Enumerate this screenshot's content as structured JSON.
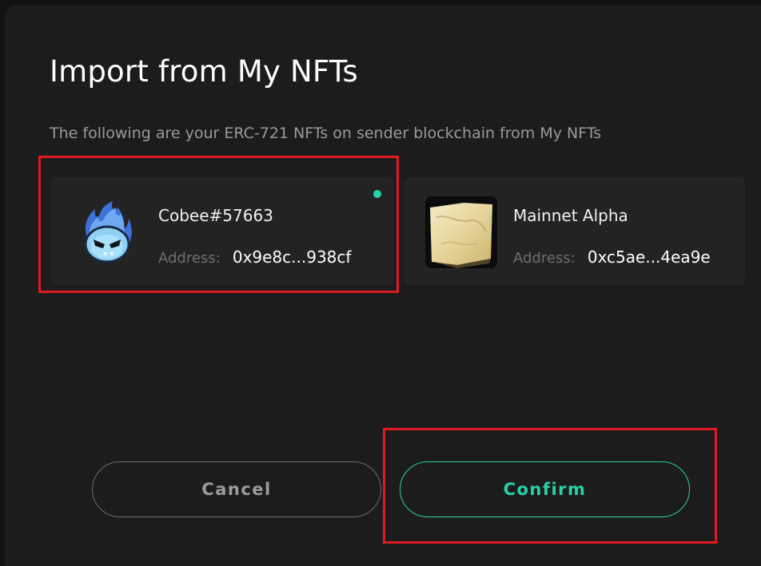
{
  "dialog": {
    "title": "Import from My NFTs",
    "subtitle": "The following are your ERC-721 NFTs on sender blockchain from My NFTs"
  },
  "nfts": [
    {
      "name": "Cobee#57663",
      "address_label": "Address:",
      "address": "0x9e8c...938cf",
      "selected": true,
      "thumbnail_icon": "blue-flame-mascot-icon"
    },
    {
      "name": "Mainnet Alpha",
      "address_label": "Address:",
      "address": "0xc5ae...4ea9e",
      "selected": false,
      "thumbnail_icon": "gold-card-icon"
    }
  ],
  "buttons": {
    "cancel": "Cancel",
    "confirm": "Confirm"
  },
  "colors": {
    "accent": "#26d3a7",
    "highlight": "#e01a1f",
    "background": "#1c1c1d",
    "card": "#232324"
  }
}
